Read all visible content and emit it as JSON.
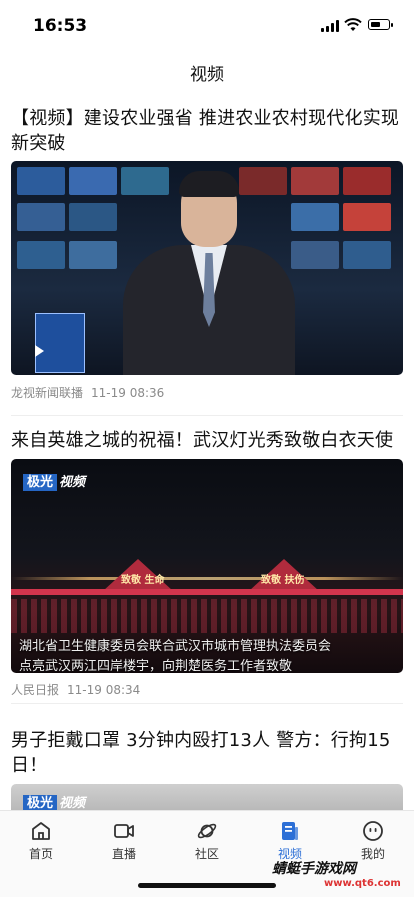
{
  "status_bar": {
    "time": "16:53"
  },
  "nav": {
    "title": "视频"
  },
  "feed": [
    {
      "title": "【视频】建设农业强省 推进农业农村现代化实现新突破",
      "source": "龙视新闻联播",
      "time": "11-19 08:36"
    },
    {
      "title": "来自英雄之城的祝福！武汉灯光秀致敬白衣天使",
      "source": "人民日报",
      "time": "11-19 08:34",
      "badge_brand": "极光",
      "badge_type": "视频",
      "caption_line1": "湖北省卫生健康委员会联合武汉市城市管理执法委员会",
      "caption_line2": "点亮武汉两江四岸楼宇，向荆楚医务工作者致敬",
      "tower_left_text": "致敬 生命",
      "tower_right_text": "致敬 扶伤"
    },
    {
      "title": "男子拒戴口罩 3分钟内殴打13人 警方：行拘15日！",
      "badge_brand": "极光",
      "badge_type": "视频"
    }
  ],
  "tabbar": {
    "items": [
      {
        "label": "首页",
        "icon": "home-icon"
      },
      {
        "label": "直播",
        "icon": "live-camera-icon"
      },
      {
        "label": "社区",
        "icon": "community-planet-icon"
      },
      {
        "label": "视频",
        "icon": "video-icon",
        "active": true
      },
      {
        "label": "我的",
        "icon": "profile-face-icon"
      }
    ]
  },
  "watermark": {
    "text": "蜻蜓手游戏网",
    "url": "www.qt6.com"
  },
  "colors": {
    "accent": "#2c6fd6",
    "meta_text": "#8a8a8a",
    "badge_blue": "#2566c4"
  }
}
